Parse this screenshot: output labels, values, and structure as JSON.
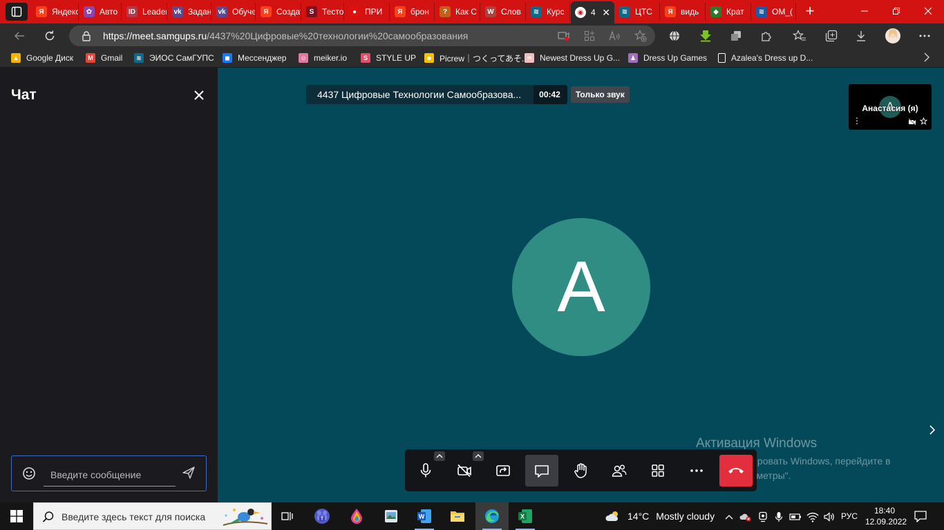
{
  "browser": {
    "tabs": [
      {
        "label": "Яндекс",
        "favicon": "yandex-icon",
        "color": "#fc3f1d",
        "glyph": "Я"
      },
      {
        "label": "Авто",
        "favicon": "pinwheel-icon",
        "color": "#8e44ad",
        "glyph": "✿"
      },
      {
        "label": "Leader-ID",
        "favicon": "leader-id-icon",
        "color": "#b03a48",
        "glyph": "ID"
      },
      {
        "label": "Задания",
        "favicon": "vk-icon",
        "color": "#5b4a8a",
        "glyph": "vk"
      },
      {
        "label": "Обучение",
        "favicon": "vk-icon",
        "color": "#5b4a8a",
        "glyph": "vk"
      },
      {
        "label": "Создать",
        "favicon": "yandex-icon",
        "color": "#fc3f1d",
        "glyph": "Я"
      },
      {
        "label": "Тесто",
        "favicon": "s-logo-icon",
        "color": "#7a1020",
        "glyph": "S"
      },
      {
        "label": "ПРИ",
        "favicon": "red-circle-icon",
        "color": "#e01010",
        "glyph": "●"
      },
      {
        "label": "брон",
        "favicon": "yandex-icon",
        "color": "#fc3f1d",
        "glyph": "Я"
      },
      {
        "label": "Как С",
        "favicon": "orange-square-icon",
        "color": "#c0601a",
        "glyph": "?"
      },
      {
        "label": "Слов",
        "favicon": "book-icon",
        "color": "#b04040",
        "glyph": "W"
      },
      {
        "label": "Курс",
        "favicon": "samgups-icon",
        "color": "#0e6a8a",
        "glyph": "≋"
      },
      {
        "label": "4",
        "favicon": "record-icon",
        "color": "#ffffff",
        "glyph": "◉"
      },
      {
        "label": "ЦТС",
        "favicon": "samgups-icon",
        "color": "#0e6a8a",
        "glyph": "≋"
      },
      {
        "label": "видь",
        "favicon": "yandex-icon",
        "color": "#fc3f1d",
        "glyph": "Я"
      },
      {
        "label": "Крат",
        "favicon": "green-game-icon",
        "color": "#2a7a2a",
        "glyph": "◆"
      },
      {
        "label": "ОМ_(",
        "favicon": "samgups-icon",
        "color": "#1a5aa8",
        "glyph": "≋"
      }
    ],
    "active_tab_index": 12,
    "url_host": "https://meet.samgups.ru",
    "url_path": "/4437%20Цифровые%20технологии%20самообразования",
    "bookmarks": [
      {
        "label": "Google Диск",
        "icon": "google-drive-icon",
        "color": "#f4b400"
      },
      {
        "label": "Gmail",
        "icon": "gmail-icon",
        "color": "#ea4335"
      },
      {
        "label": "ЭИОС СамГУПС",
        "icon": "samgups-icon",
        "color": "#0e6a8a"
      },
      {
        "label": "Мессенджер",
        "icon": "messenger-icon",
        "color": "#1877f2"
      },
      {
        "label": "meiker.io",
        "icon": "meiker-icon",
        "color": "#e07aa0"
      },
      {
        "label": "STYLE UP",
        "icon": "style-up-icon",
        "color": "#e0506a"
      },
      {
        "label": "Picrew｜つくってあそ...",
        "icon": "picrew-icon",
        "color": "#f4c000"
      },
      {
        "label": "Newest Dress Up G...",
        "icon": "shell-icon",
        "color": "#f0c0c0"
      },
      {
        "label": "Dress Up Games",
        "icon": "doll-icon",
        "color": "#a070c0"
      },
      {
        "label": "Azalea's Dress up D...",
        "icon": "page-icon",
        "color": "#ffffff"
      }
    ]
  },
  "chat": {
    "title": "Чат",
    "input_placeholder": "Введите сообщение"
  },
  "meeting": {
    "name": "4437 Цифровые Технологии Самообразова...",
    "timer": "00:42",
    "audio_only": "Только звук",
    "main_avatar_letter": "A",
    "self": {
      "name": "Анастасия (я)",
      "avatar_letter": "A"
    },
    "controls": [
      {
        "name": "microphone",
        "icon": "microphone-icon",
        "active": false,
        "has_caret": true
      },
      {
        "name": "camera",
        "icon": "camera-off-icon",
        "active": false,
        "has_caret": true
      },
      {
        "name": "screen-share",
        "icon": "screen-share-icon",
        "active": false,
        "has_caret": false
      },
      {
        "name": "chat",
        "icon": "chat-icon",
        "active": true,
        "has_caret": false
      },
      {
        "name": "raise-hand",
        "icon": "hand-icon",
        "active": false,
        "has_caret": false
      },
      {
        "name": "participants",
        "icon": "participants-icon",
        "active": false,
        "has_caret": false
      },
      {
        "name": "tile-view",
        "icon": "grid-icon",
        "active": false,
        "has_caret": false
      },
      {
        "name": "more",
        "icon": "more-icon",
        "active": false,
        "has_caret": false
      },
      {
        "name": "hangup",
        "icon": "hangup-icon",
        "active": false,
        "has_caret": false
      }
    ],
    "colors": {
      "stage": "#04495a",
      "avatar": "#2f8d83",
      "hangup": "#e32f3d",
      "chat_panel": "#1b1b1f"
    }
  },
  "watermark": {
    "title": "Активация Windows",
    "text": "Чтобы активировать Windows, перейдите в раздел \"Параметры\"."
  },
  "taskbar": {
    "search_placeholder": "Введите здесь текст для поиска",
    "apps": [
      "task-view-icon",
      "teams-icon",
      "paint-icon",
      "photos-icon",
      "word-icon",
      "file-explorer-icon",
      "edge-icon",
      "excel-icon"
    ],
    "active_app": "edge-icon",
    "weather_temp": "14°C",
    "weather_condition": "Mostly cloudy",
    "language": "РУС",
    "time": "18:40",
    "date": "12.09.2022"
  }
}
